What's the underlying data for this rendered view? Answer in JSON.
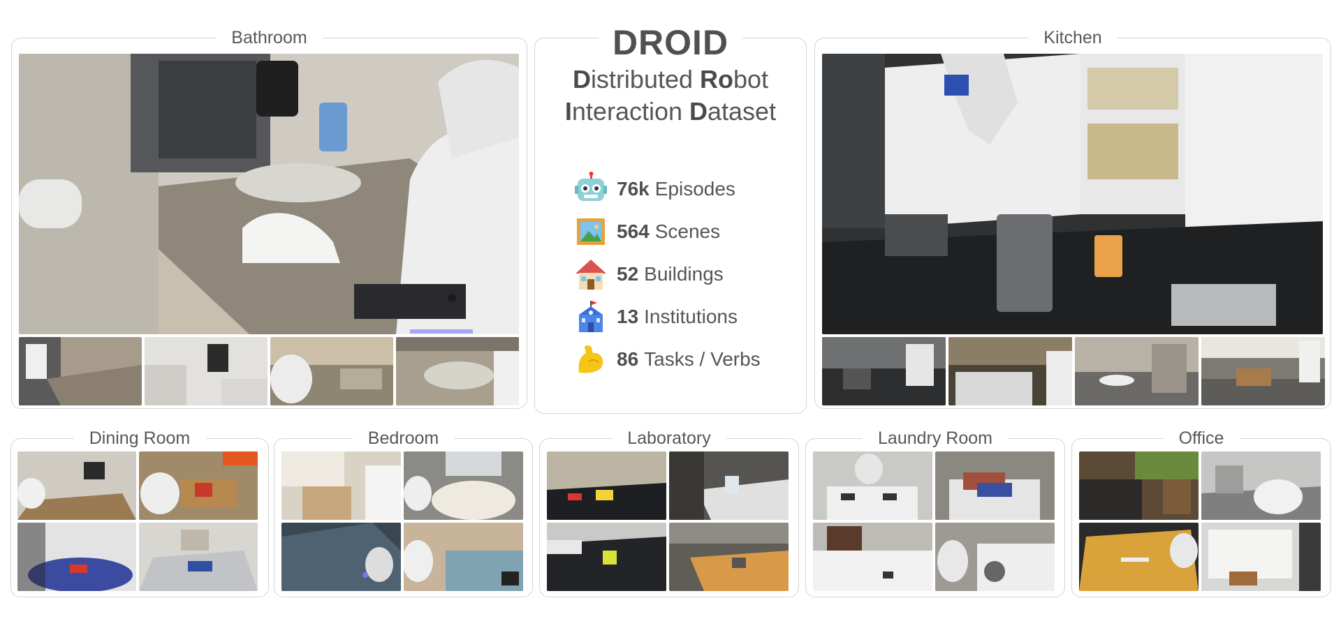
{
  "panels": {
    "bathroom": "Bathroom",
    "kitchen": "Kitchen",
    "dining_room": "Dining Room",
    "bedroom": "Bedroom",
    "laboratory": "Laboratory",
    "laundry_room": "Laundry Room",
    "office": "Office"
  },
  "droid": {
    "title": "DROID",
    "subtitle_line1": {
      "w1b": "D",
      "w1": "istributed ",
      "w2b": "Ro",
      "w2": "bot"
    },
    "subtitle_line2": {
      "w1b": "I",
      "w1": "nteraction ",
      "w2b": "D",
      "w2": "ataset"
    },
    "stats": [
      {
        "icon": "robot-icon",
        "value": "76k",
        "label": "Episodes"
      },
      {
        "icon": "framed-picture-icon",
        "value": "564",
        "label": "Scenes"
      },
      {
        "icon": "house-icon",
        "value": "52",
        "label": "Buildings"
      },
      {
        "icon": "school-icon",
        "value": "13",
        "label": "Institutions"
      },
      {
        "icon": "flexed-bicep-icon",
        "value": "86",
        "label": "Tasks / Verbs"
      }
    ]
  },
  "colors": {
    "border": "#d4d4d4",
    "title_text": "#575757",
    "robot_white": "#f2f2f2"
  }
}
